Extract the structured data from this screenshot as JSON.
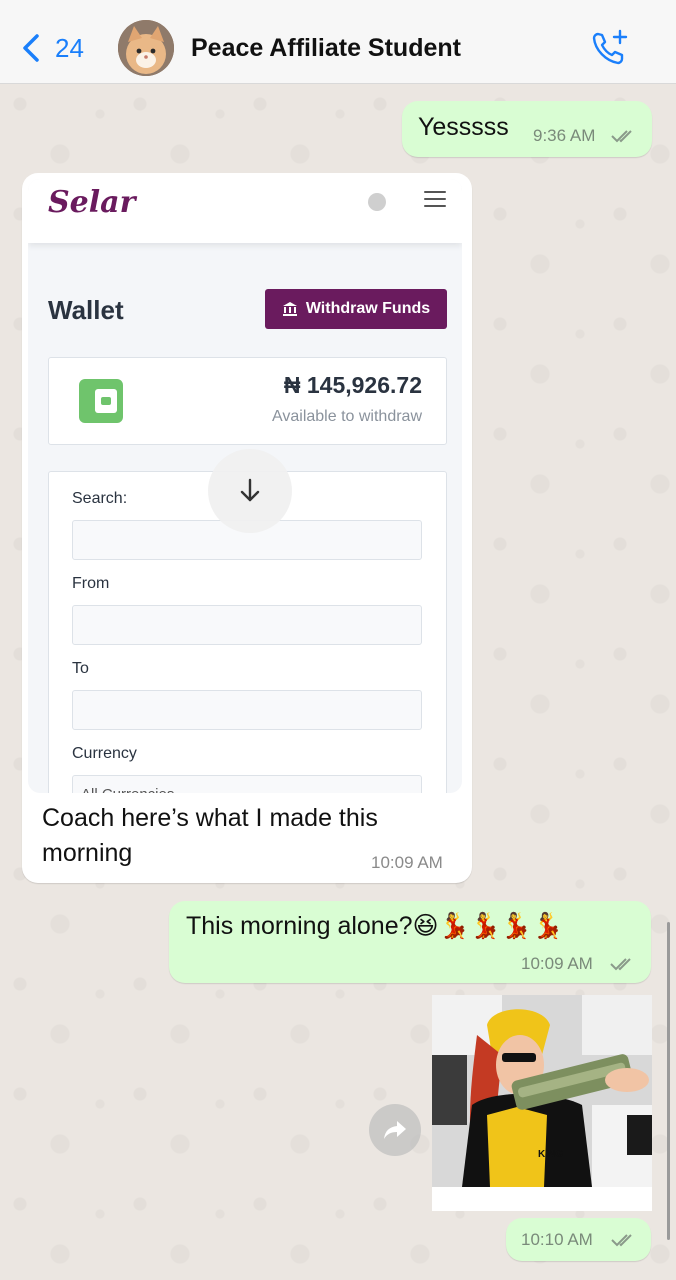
{
  "header": {
    "back_count": "24",
    "title": "Peace Affiliate Student"
  },
  "messages": {
    "m1": {
      "text": "Yesssss",
      "time": "9:36 AM"
    },
    "m2": {
      "caption": "Coach here’s what I made this morning",
      "time": "10:09 AM",
      "screenshot": {
        "logo": "Selar",
        "wallet_title": "Wallet",
        "withdraw_label": "Withdraw Funds",
        "balance": "₦ 145,926.72",
        "balance_sub": "Available to withdraw",
        "search_label": "Search:",
        "from_label": "From",
        "to_label": "To",
        "currency_label": "Currency",
        "currency_value": "All Currencies"
      }
    },
    "m3": {
      "text": "This morning alone?😆💃💃💃💃",
      "time": "10:09 AM"
    },
    "m4": {
      "time": "10:10 AM",
      "photo_text": "KING"
    }
  },
  "colors": {
    "outgoing_bubble": "#d9fdd3",
    "incoming_bubble": "#ffffff",
    "accent_blue": "#1a7ffb",
    "selar_purple": "#6a1b5e",
    "wallet_green": "#6fc46c"
  },
  "icons": [
    "chevron-left-icon",
    "call-add-icon",
    "double-check-icon",
    "arrow-down-icon",
    "forward-icon",
    "bank-icon",
    "wallet-icon",
    "menu-icon"
  ]
}
